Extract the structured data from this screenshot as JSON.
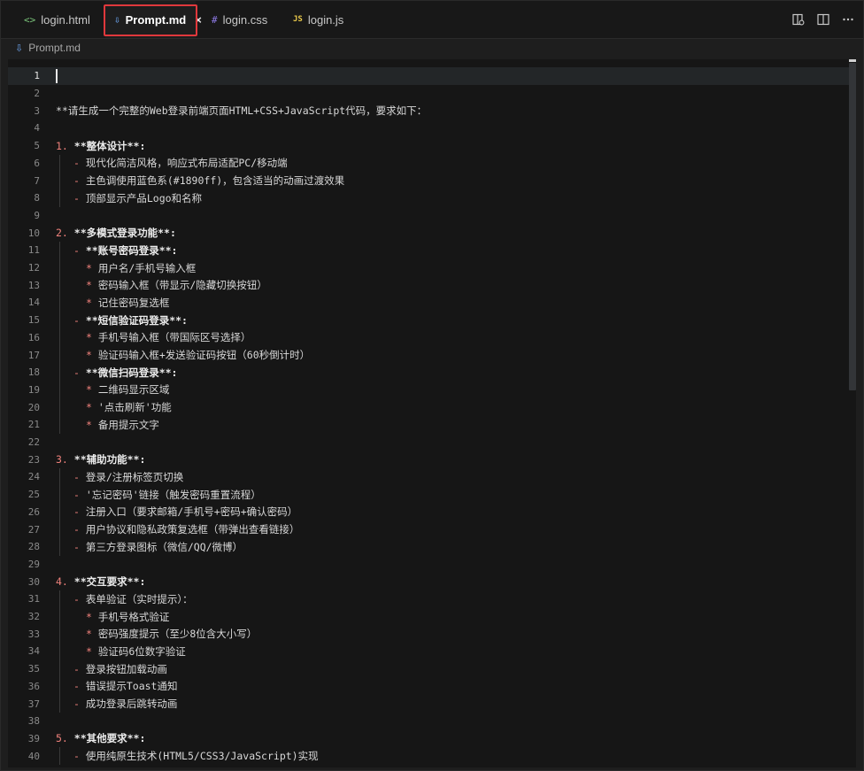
{
  "tabs": [
    {
      "label": "login.html",
      "icon": "<>",
      "icon_name": "html-file-icon",
      "icon_color": "#7bc67b",
      "active": false
    },
    {
      "label": "Prompt.md",
      "icon": "⇩",
      "icon_name": "markdown-file-icon",
      "icon_color": "#6aa0e8",
      "active": true,
      "close": "×"
    },
    {
      "label": "login.css",
      "icon": "#",
      "icon_name": "css-file-icon",
      "icon_color": "#8f7be8",
      "active": false
    },
    {
      "label": "login.js",
      "icon": "JS",
      "icon_name": "js-file-icon",
      "icon_color": "#e8c84a",
      "active": false
    }
  ],
  "breadcrumb": {
    "icon": "⇩",
    "label": "Prompt.md"
  },
  "editor": {
    "current_line": 1,
    "lines": [
      {
        "n": "1",
        "parts": []
      },
      {
        "n": "2",
        "parts": []
      },
      {
        "n": "3",
        "parts": [
          {
            "t": "**请生成一个完整的Web登录前端页面HTML+CSS+JavaScript代码，要求如下：",
            "c": "tx"
          }
        ]
      },
      {
        "n": "4",
        "parts": []
      },
      {
        "n": "5",
        "parts": [
          {
            "t": "1. ",
            "c": "num"
          },
          {
            "t": "**整体设计**:",
            "c": "bold"
          }
        ]
      },
      {
        "n": "6",
        "indent": 1,
        "parts": [
          {
            "t": "- ",
            "c": "dash"
          },
          {
            "t": "现代化简洁风格，响应式布局适配PC/移动端",
            "c": "tx"
          }
        ]
      },
      {
        "n": "7",
        "indent": 1,
        "parts": [
          {
            "t": "- ",
            "c": "dash"
          },
          {
            "t": "主色调使用蓝色系(#1890ff)，包含适当的动画过渡效果",
            "c": "tx"
          }
        ]
      },
      {
        "n": "8",
        "indent": 1,
        "parts": [
          {
            "t": "- ",
            "c": "dash"
          },
          {
            "t": "顶部显示产品Logo和名称",
            "c": "tx"
          }
        ]
      },
      {
        "n": "9",
        "parts": []
      },
      {
        "n": "10",
        "parts": [
          {
            "t": "2. ",
            "c": "num"
          },
          {
            "t": "**多模式登录功能**:",
            "c": "bold"
          }
        ]
      },
      {
        "n": "11",
        "indent": 1,
        "parts": [
          {
            "t": "- ",
            "c": "dash"
          },
          {
            "t": "**账号密码登录**:",
            "c": "bold"
          }
        ]
      },
      {
        "n": "12",
        "indent": 2,
        "parts": [
          {
            "t": "* ",
            "c": "star"
          },
          {
            "t": "用户名/手机号输入框",
            "c": "tx"
          }
        ]
      },
      {
        "n": "13",
        "indent": 2,
        "parts": [
          {
            "t": "* ",
            "c": "star"
          },
          {
            "t": "密码输入框（带显示/隐藏切换按钮）",
            "c": "tx"
          }
        ]
      },
      {
        "n": "14",
        "indent": 2,
        "parts": [
          {
            "t": "* ",
            "c": "star"
          },
          {
            "t": "记住密码复选框",
            "c": "tx"
          }
        ]
      },
      {
        "n": "15",
        "indent": 1,
        "parts": [
          {
            "t": "- ",
            "c": "dash"
          },
          {
            "t": "**短信验证码登录**:",
            "c": "bold"
          }
        ]
      },
      {
        "n": "16",
        "indent": 2,
        "parts": [
          {
            "t": "* ",
            "c": "star"
          },
          {
            "t": "手机号输入框（带国际区号选择）",
            "c": "tx"
          }
        ]
      },
      {
        "n": "17",
        "indent": 2,
        "parts": [
          {
            "t": "* ",
            "c": "star"
          },
          {
            "t": "验证码输入框+发送验证码按钮（60秒倒计时）",
            "c": "tx"
          }
        ]
      },
      {
        "n": "18",
        "indent": 1,
        "parts": [
          {
            "t": "- ",
            "c": "dash"
          },
          {
            "t": "**微信扫码登录**:",
            "c": "bold"
          }
        ]
      },
      {
        "n": "19",
        "indent": 2,
        "parts": [
          {
            "t": "* ",
            "c": "star"
          },
          {
            "t": "二维码显示区域",
            "c": "tx"
          }
        ]
      },
      {
        "n": "20",
        "indent": 2,
        "parts": [
          {
            "t": "* ",
            "c": "star"
          },
          {
            "t": "'点击刷新'功能",
            "c": "tx"
          }
        ]
      },
      {
        "n": "21",
        "indent": 2,
        "parts": [
          {
            "t": "* ",
            "c": "star"
          },
          {
            "t": "备用提示文字",
            "c": "tx"
          }
        ]
      },
      {
        "n": "22",
        "parts": []
      },
      {
        "n": "23",
        "parts": [
          {
            "t": "3. ",
            "c": "num"
          },
          {
            "t": "**辅助功能**:",
            "c": "bold"
          }
        ]
      },
      {
        "n": "24",
        "indent": 1,
        "parts": [
          {
            "t": "- ",
            "c": "dash"
          },
          {
            "t": "登录/注册标签页切换",
            "c": "tx"
          }
        ]
      },
      {
        "n": "25",
        "indent": 1,
        "parts": [
          {
            "t": "- ",
            "c": "dash"
          },
          {
            "t": "'忘记密码'链接（触发密码重置流程）",
            "c": "tx"
          }
        ]
      },
      {
        "n": "26",
        "indent": 1,
        "parts": [
          {
            "t": "- ",
            "c": "dash"
          },
          {
            "t": "注册入口（要求邮箱/手机号+密码+确认密码）",
            "c": "tx"
          }
        ]
      },
      {
        "n": "27",
        "indent": 1,
        "parts": [
          {
            "t": "- ",
            "c": "dash"
          },
          {
            "t": "用户协议和隐私政策复选框（带弹出查看链接）",
            "c": "tx"
          }
        ]
      },
      {
        "n": "28",
        "indent": 1,
        "parts": [
          {
            "t": "- ",
            "c": "dash"
          },
          {
            "t": "第三方登录图标（微信/QQ/微博）",
            "c": "tx"
          }
        ]
      },
      {
        "n": "29",
        "parts": []
      },
      {
        "n": "30",
        "parts": [
          {
            "t": "4. ",
            "c": "num"
          },
          {
            "t": "**交互要求**:",
            "c": "bold"
          }
        ]
      },
      {
        "n": "31",
        "indent": 1,
        "parts": [
          {
            "t": "- ",
            "c": "dash"
          },
          {
            "t": "表单验证（实时提示）：",
            "c": "tx"
          }
        ]
      },
      {
        "n": "32",
        "indent": 2,
        "parts": [
          {
            "t": "* ",
            "c": "star"
          },
          {
            "t": "手机号格式验证",
            "c": "tx"
          }
        ]
      },
      {
        "n": "33",
        "indent": 2,
        "parts": [
          {
            "t": "* ",
            "c": "star"
          },
          {
            "t": "密码强度提示（至少8位含大小写）",
            "c": "tx"
          }
        ]
      },
      {
        "n": "34",
        "indent": 2,
        "parts": [
          {
            "t": "* ",
            "c": "star"
          },
          {
            "t": "验证码6位数字验证",
            "c": "tx"
          }
        ]
      },
      {
        "n": "35",
        "indent": 1,
        "parts": [
          {
            "t": "- ",
            "c": "dash"
          },
          {
            "t": "登录按钮加载动画",
            "c": "tx"
          }
        ]
      },
      {
        "n": "36",
        "indent": 1,
        "parts": [
          {
            "t": "- ",
            "c": "dash"
          },
          {
            "t": "错误提示Toast通知",
            "c": "tx"
          }
        ]
      },
      {
        "n": "37",
        "indent": 1,
        "parts": [
          {
            "t": "- ",
            "c": "dash"
          },
          {
            "t": "成功登录后跳转动画",
            "c": "tx"
          }
        ]
      },
      {
        "n": "38",
        "parts": []
      },
      {
        "n": "39",
        "parts": [
          {
            "t": "5. ",
            "c": "num"
          },
          {
            "t": "**其他要求**:",
            "c": "bold"
          }
        ]
      },
      {
        "n": "40",
        "indent": 1,
        "parts": [
          {
            "t": "- ",
            "c": "dash"
          },
          {
            "t": "使用纯原生技术(HTML5/CSS3/JavaScript)实现",
            "c": "tx"
          }
        ]
      }
    ]
  },
  "colors": {
    "highlight_border": "#e0383c",
    "accent": "#f0827c",
    "background": "#1e1e1e"
  },
  "toolbar_icons": [
    "open-preview-icon",
    "split-editor-icon",
    "more-actions-icon"
  ]
}
